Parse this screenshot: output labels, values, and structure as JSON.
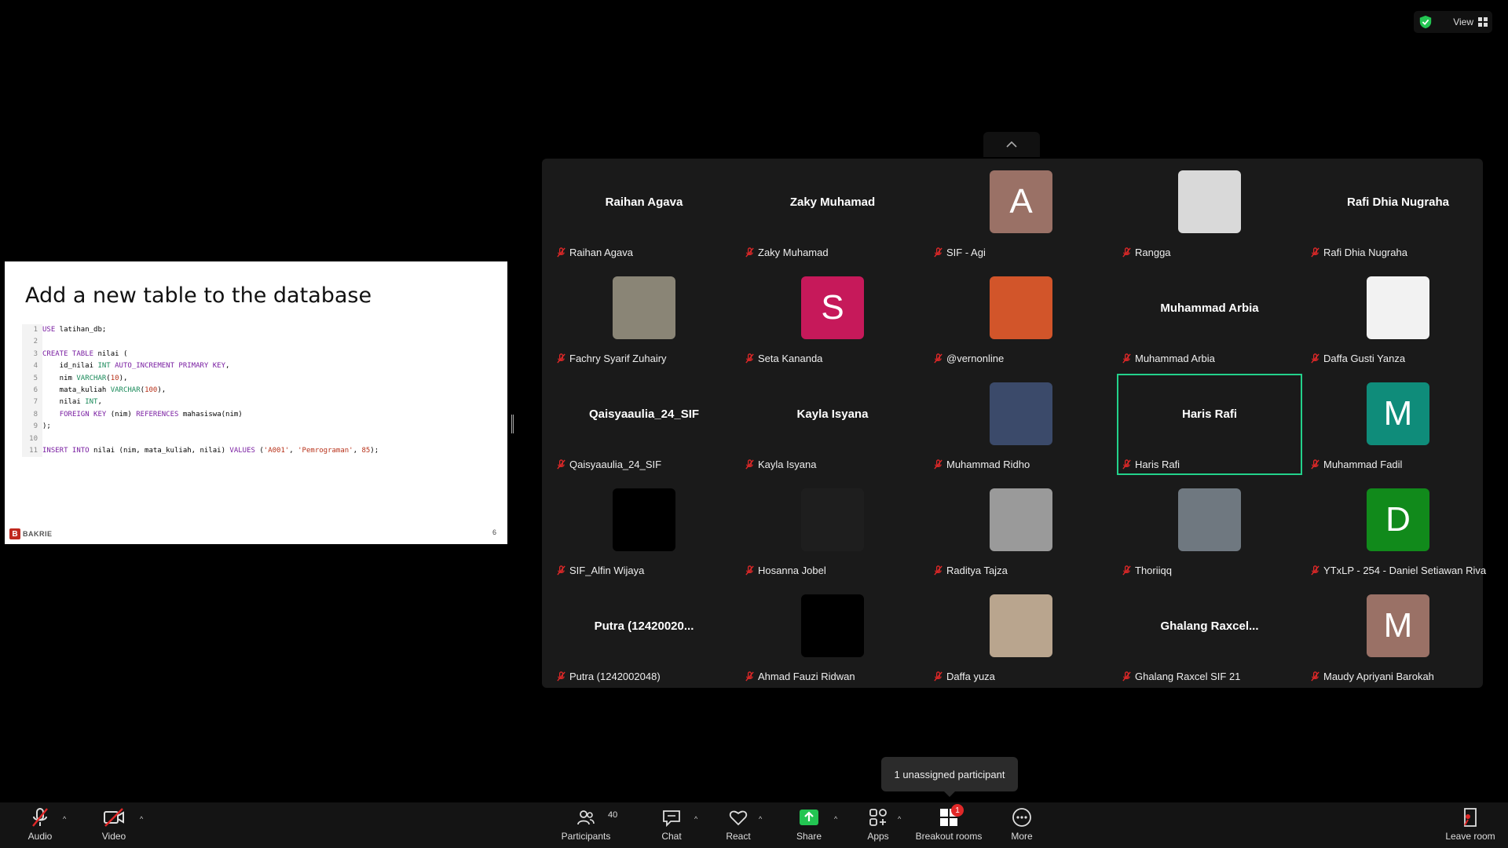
{
  "header": {
    "view_label": "View"
  },
  "slide": {
    "title": "Add a new table to the database",
    "code_lines": [
      {
        "n": "1",
        "html": "<span class=\"kw\">USE</span> latihan_db;"
      },
      {
        "n": "2",
        "html": ""
      },
      {
        "n": "3",
        "html": "<span class=\"kw\">CREATE TABLE</span> nilai ("
      },
      {
        "n": "4",
        "html": "    id_nilai <span class=\"ty\">INT</span> <span class=\"kw\">AUTO_INCREMENT PRIMARY KEY</span>,"
      },
      {
        "n": "5",
        "html": "    nim <span class=\"ty\">VARCHAR</span>(<span class=\"st\">10</span>),"
      },
      {
        "n": "6",
        "html": "    mata_kuliah <span class=\"ty\">VARCHAR</span>(<span class=\"st\">100</span>),"
      },
      {
        "n": "7",
        "html": "    nilai <span class=\"ty\">INT</span>,"
      },
      {
        "n": "8",
        "html": "    <span class=\"kw\">FOREIGN KEY</span> (nim) <span class=\"kw\">REFERENCES</span> mahasiswa(nim)"
      },
      {
        "n": "9",
        "html": ");"
      },
      {
        "n": "10",
        "html": ""
      },
      {
        "n": "11",
        "html": "<span class=\"kw\">INSERT INTO</span> nilai (nim, mata_kuliah, nilai) <span class=\"kw\">VALUES</span> (<span class=\"st\">'A001'</span>, <span class=\"st\">'Pemrograman'</span>, <span class=\"st\">85</span>);"
      }
    ],
    "logo_text": "BAKRIE",
    "page_number": "6"
  },
  "participants": [
    {
      "name": "Raihan Agava",
      "display": "name",
      "big": "Raihan Agava"
    },
    {
      "name": "Zaky Muhamad",
      "display": "name",
      "big": "Zaky Muhamad"
    },
    {
      "name": "SIF - Agi",
      "display": "letter",
      "letter": "A",
      "color": "#9a7166"
    },
    {
      "name": "Rangga",
      "display": "photo",
      "color": "#d9d9d9"
    },
    {
      "name": "Rafi Dhia Nugraha",
      "display": "name",
      "big": "Rafi Dhia Nugraha"
    },
    {
      "name": "Fachry Syarif Zuhairy",
      "display": "photo",
      "color": "#8a8576"
    },
    {
      "name": "Seta Kananda",
      "display": "letter",
      "letter": "S",
      "color": "#c6195a"
    },
    {
      "name": "@vernonline",
      "display": "photo",
      "color": "#d2552a"
    },
    {
      "name": "Muhammad Arbia",
      "display": "name",
      "big": "Muhammad Arbia"
    },
    {
      "name": "Daffa Gusti Yanza",
      "display": "photo",
      "color": "#f2f2f2"
    },
    {
      "name": "Qaisyaaulia_24_SIF",
      "display": "name",
      "big": "Qaisyaaulia_24_SIF"
    },
    {
      "name": "Kayla Isyana",
      "display": "name",
      "big": "Kayla Isyana"
    },
    {
      "name": "Muhammad Ridho",
      "display": "photo",
      "color": "#3b4a6a"
    },
    {
      "name": "Haris Rafi",
      "display": "name",
      "big": "Haris Rafi",
      "active": true
    },
    {
      "name": "Muhammad Fadil",
      "display": "letter",
      "letter": "M",
      "color": "#0f8c7a"
    },
    {
      "name": "SIF_Alfin Wijaya",
      "display": "photo",
      "color": "#000000"
    },
    {
      "name": "Hosanna Jobel",
      "display": "photo",
      "color": "#1e1e1e"
    },
    {
      "name": "Raditya Tajza",
      "display": "photo",
      "color": "#9a9a9a"
    },
    {
      "name": "Thoriiqq",
      "display": "photo",
      "color": "#6f7880"
    },
    {
      "name": "YTxLP - 254 - Daniel Setiawan Riva",
      "display": "letter",
      "letter": "D",
      "color": "#118a1b"
    },
    {
      "name": "Putra (1242002048)",
      "display": "name",
      "big": "Putra (12420020..."
    },
    {
      "name": "Ahmad Fauzi Ridwan",
      "display": "photo",
      "color": "#000000"
    },
    {
      "name": "Daffa yuza",
      "display": "photo",
      "color": "#b9a58e"
    },
    {
      "name": "Ghalang Raxcel SIF 21",
      "display": "name",
      "big": "Ghalang  Raxcel..."
    },
    {
      "name": "Maudy Apriyani Barokah",
      "display": "letter",
      "letter": "M",
      "color": "#9a7166"
    }
  ],
  "tooltip": "1 unassigned participant",
  "toolbar": {
    "audio": "Audio",
    "video": "Video",
    "participants": "Participants",
    "participants_count": "40",
    "chat": "Chat",
    "react": "React",
    "share": "Share",
    "apps": "Apps",
    "breakout": "Breakout rooms",
    "breakout_badge": "1",
    "more": "More",
    "leave": "Leave room"
  },
  "colors": {
    "active_border": "#23d18b",
    "share_green": "#23c552",
    "mic_red": "#e02828"
  }
}
